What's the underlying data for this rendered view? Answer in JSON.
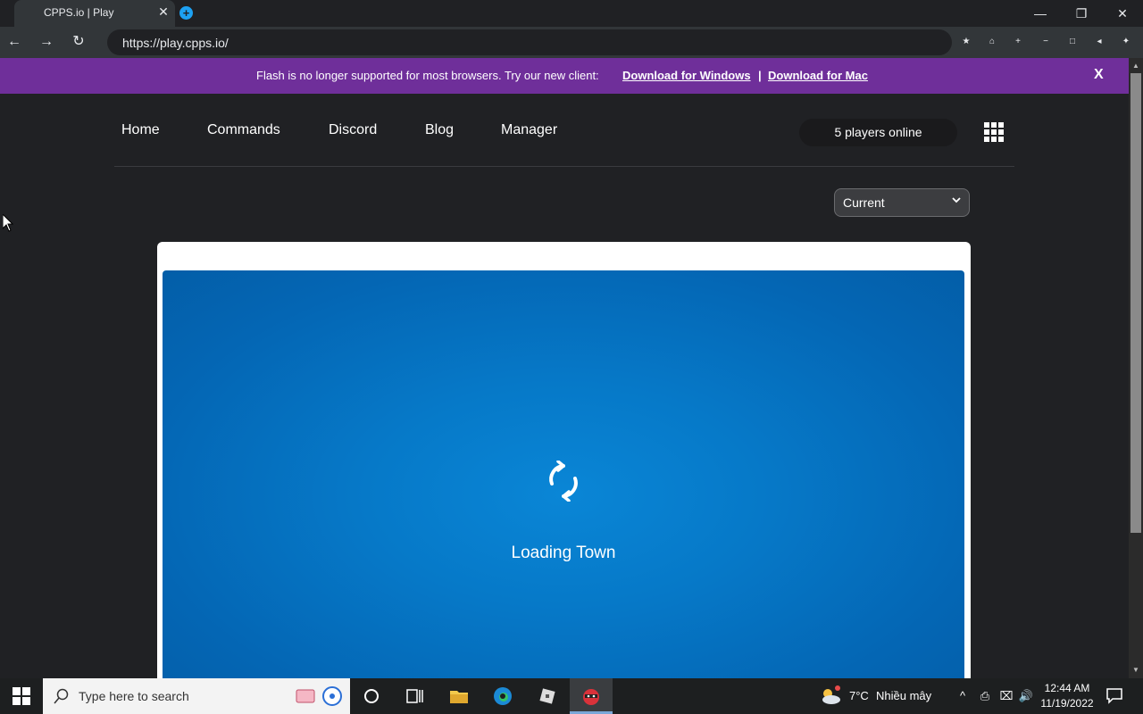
{
  "browser": {
    "tab_title": "CPPS.io | Play",
    "tab_close": "✕",
    "new_tab": "+",
    "url": "https://play.cpps.io/",
    "window_controls": {
      "minimize": "—",
      "restore": "❐",
      "close": "✕"
    },
    "nav": {
      "back": "←",
      "forward": "→",
      "reload": "↻"
    },
    "toolbar_icons": [
      "★",
      "⌂",
      "+",
      "−",
      "□",
      "◂",
      "✦"
    ]
  },
  "banner": {
    "text": "Flash is no longer supported for most browsers. Try our new client:",
    "link_windows": "Download for Windows",
    "separator": "|",
    "link_mac": "Download for Mac",
    "close": "X",
    "color": "#6f2f9a"
  },
  "nav": {
    "items": [
      "Home",
      "Commands",
      "Discord",
      "Blog",
      "Manager"
    ],
    "players_online": "5 players online"
  },
  "version_select": {
    "selected": "Current",
    "chevron": "⌄"
  },
  "game": {
    "loading_text": "Loading Town",
    "background_color": "#0679c8"
  },
  "taskbar": {
    "search_placeholder": "Type here to search",
    "weather": "7°C",
    "weather_desc": "Nhiều mây",
    "time": "12:44 AM",
    "date": "11/19/2022",
    "tray_icons": [
      "^",
      "⎙",
      "⌧",
      "🔊"
    ]
  }
}
